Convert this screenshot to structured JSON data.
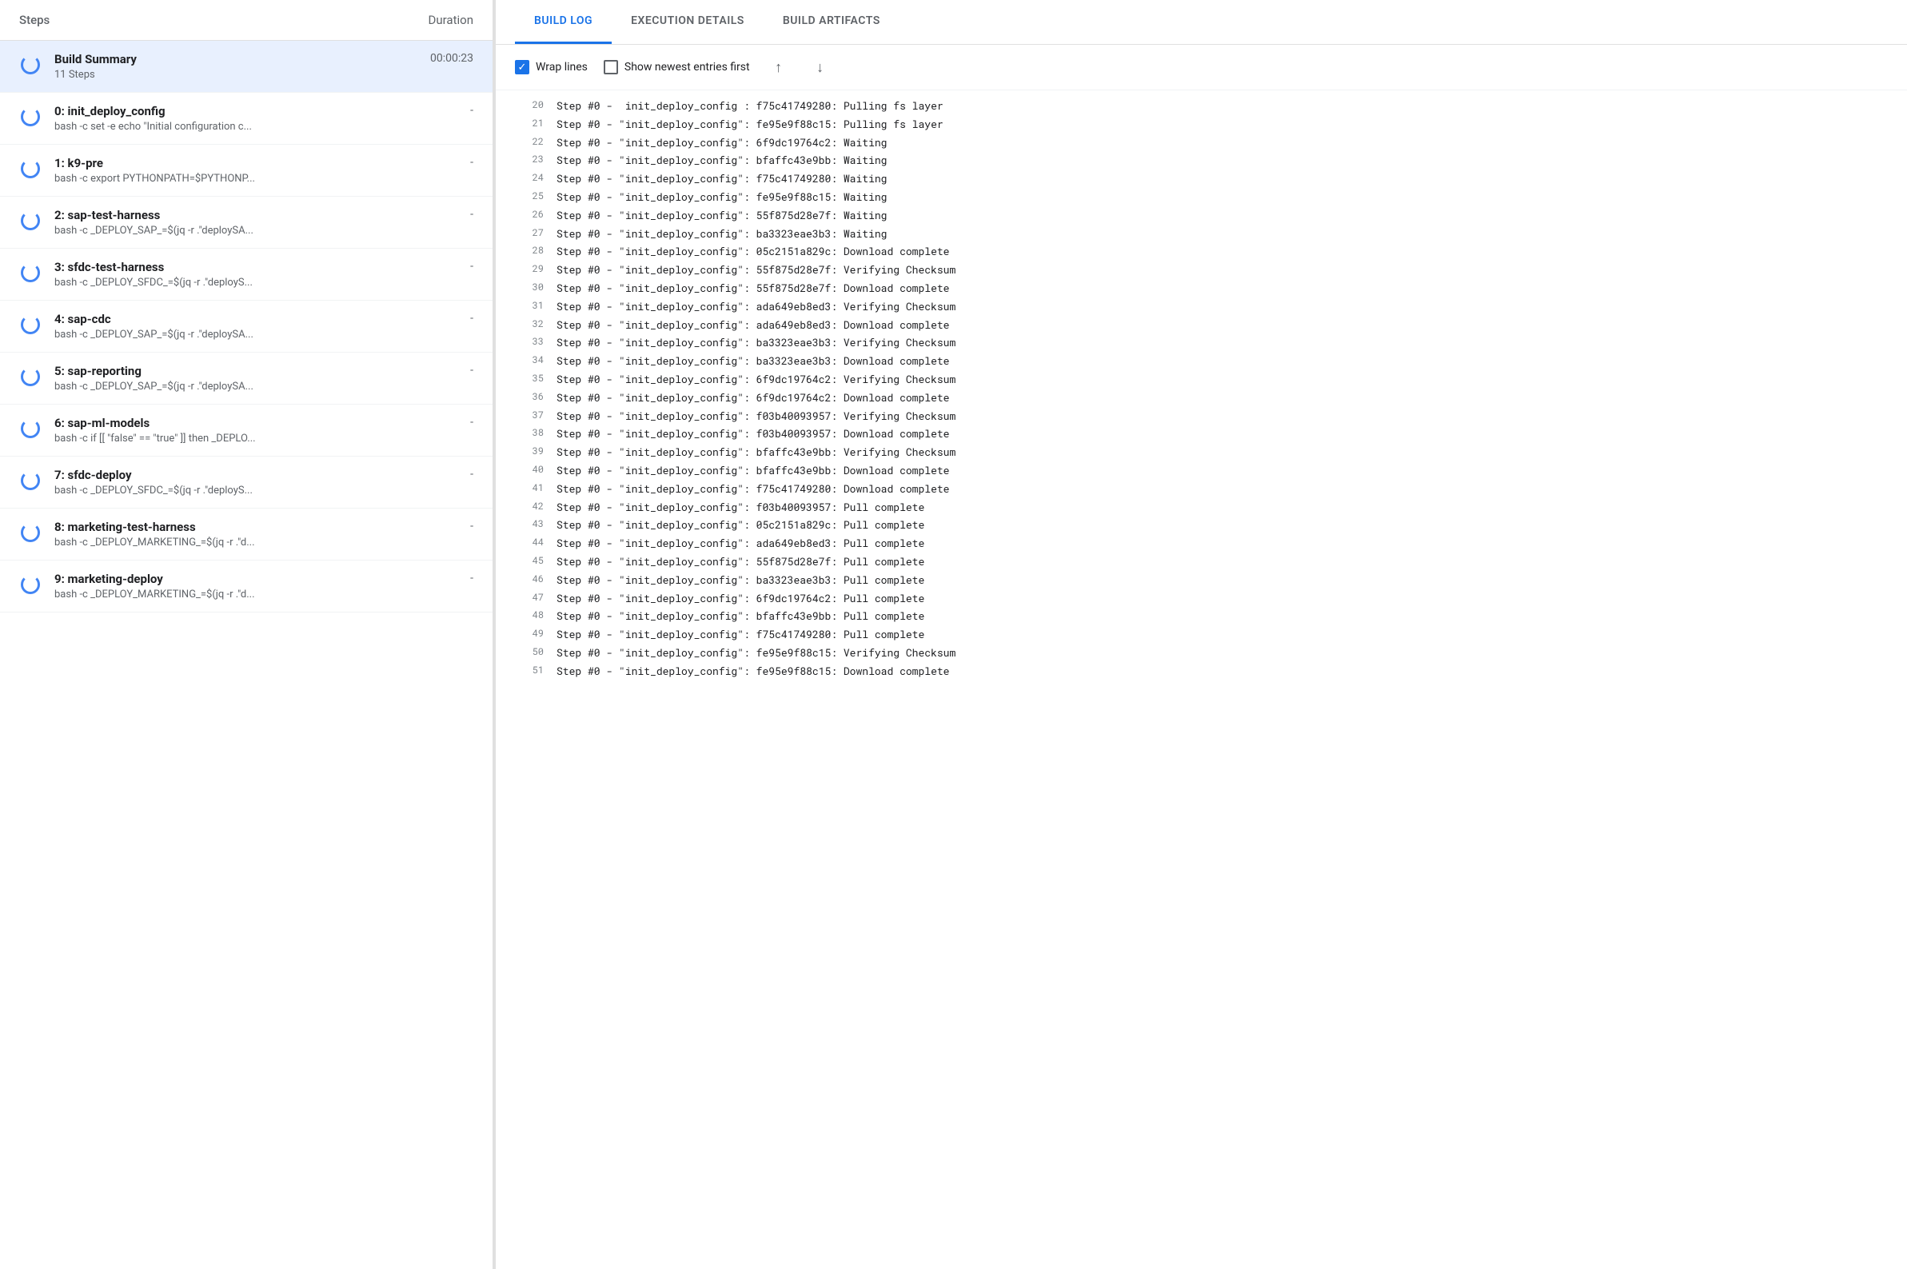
{
  "left": {
    "header": {
      "steps_label": "Steps",
      "duration_label": "Duration"
    },
    "summary": {
      "title": "Build Summary",
      "subtitle": "11 Steps",
      "duration": "00:00:23"
    },
    "steps": [
      {
        "id": 0,
        "name": "0: init_deploy_config",
        "command": "bash -c set -e echo \"Initial configuration c...",
        "duration": "-"
      },
      {
        "id": 1,
        "name": "1: k9-pre",
        "command": "bash -c export PYTHONPATH=$PYTHONP...",
        "duration": "-"
      },
      {
        "id": 2,
        "name": "2: sap-test-harness",
        "command": "bash -c _DEPLOY_SAP_=$(jq -r .\"deploySA...",
        "duration": "-"
      },
      {
        "id": 3,
        "name": "3: sfdc-test-harness",
        "command": "bash -c _DEPLOY_SFDC_=$(jq -r .\"deployS...",
        "duration": "-"
      },
      {
        "id": 4,
        "name": "4: sap-cdc",
        "command": "bash -c _DEPLOY_SAP_=$(jq -r .\"deploySA...",
        "duration": "-"
      },
      {
        "id": 5,
        "name": "5: sap-reporting",
        "command": "bash -c _DEPLOY_SAP_=$(jq -r .\"deploySA...",
        "duration": "-"
      },
      {
        "id": 6,
        "name": "6: sap-ml-models",
        "command": "bash -c if [[ \"false\" == \"true\" ]] then _DEPLO...",
        "duration": "-"
      },
      {
        "id": 7,
        "name": "7: sfdc-deploy",
        "command": "bash -c _DEPLOY_SFDC_=$(jq -r .\"deployS...",
        "duration": "-"
      },
      {
        "id": 8,
        "name": "8: marketing-test-harness",
        "command": "bash -c _DEPLOY_MARKETING_=$(jq -r .\"d...",
        "duration": "-"
      },
      {
        "id": 9,
        "name": "9: marketing-deploy",
        "command": "bash -c _DEPLOY_MARKETING_=$(jq -r .\"d...",
        "duration": "-"
      }
    ]
  },
  "right": {
    "tabs": [
      {
        "label": "BUILD LOG",
        "active": true
      },
      {
        "label": "EXECUTION DETAILS",
        "active": false
      },
      {
        "label": "BUILD ARTIFACTS",
        "active": false
      }
    ],
    "toolbar": {
      "wrap_lines_label": "Wrap lines",
      "wrap_lines_checked": true,
      "show_newest_label": "Show newest entries first",
      "show_newest_checked": false,
      "scroll_top_icon": "↑",
      "scroll_bottom_icon": "↓"
    },
    "log_lines": [
      {
        "num": 20,
        "text": "Step #0 -  init_deploy_config : f75c41749280: Pulling fs layer"
      },
      {
        "num": 21,
        "text": "Step #0 - \"init_deploy_config\": fe95e9f88c15: Pulling fs layer"
      },
      {
        "num": 22,
        "text": "Step #0 - \"init_deploy_config\": 6f9dc19764c2: Waiting"
      },
      {
        "num": 23,
        "text": "Step #0 - \"init_deploy_config\": bfaffc43e9bb: Waiting"
      },
      {
        "num": 24,
        "text": "Step #0 - \"init_deploy_config\": f75c41749280: Waiting"
      },
      {
        "num": 25,
        "text": "Step #0 - \"init_deploy_config\": fe95e9f88c15: Waiting"
      },
      {
        "num": 26,
        "text": "Step #0 - \"init_deploy_config\": 55f875d28e7f: Waiting"
      },
      {
        "num": 27,
        "text": "Step #0 - \"init_deploy_config\": ba3323eae3b3: Waiting"
      },
      {
        "num": 28,
        "text": "Step #0 - \"init_deploy_config\": 05c2151a829c: Download complete"
      },
      {
        "num": 29,
        "text": "Step #0 - \"init_deploy_config\": 55f875d28e7f: Verifying Checksum"
      },
      {
        "num": 30,
        "text": "Step #0 - \"init_deploy_config\": 55f875d28e7f: Download complete"
      },
      {
        "num": 31,
        "text": "Step #0 - \"init_deploy_config\": ada649eb8ed3: Verifying Checksum"
      },
      {
        "num": 32,
        "text": "Step #0 - \"init_deploy_config\": ada649eb8ed3: Download complete"
      },
      {
        "num": 33,
        "text": "Step #0 - \"init_deploy_config\": ba3323eae3b3: Verifying Checksum"
      },
      {
        "num": 34,
        "text": "Step #0 - \"init_deploy_config\": ba3323eae3b3: Download complete"
      },
      {
        "num": 35,
        "text": "Step #0 - \"init_deploy_config\": 6f9dc19764c2: Verifying Checksum"
      },
      {
        "num": 36,
        "text": "Step #0 - \"init_deploy_config\": 6f9dc19764c2: Download complete"
      },
      {
        "num": 37,
        "text": "Step #0 - \"init_deploy_config\": f03b40093957: Verifying Checksum"
      },
      {
        "num": 38,
        "text": "Step #0 - \"init_deploy_config\": f03b40093957: Download complete"
      },
      {
        "num": 39,
        "text": "Step #0 - \"init_deploy_config\": bfaffc43e9bb: Verifying Checksum"
      },
      {
        "num": 40,
        "text": "Step #0 - \"init_deploy_config\": bfaffc43e9bb: Download complete"
      },
      {
        "num": 41,
        "text": "Step #0 - \"init_deploy_config\": f75c41749280: Download complete"
      },
      {
        "num": 42,
        "text": "Step #0 - \"init_deploy_config\": f03b40093957: Pull complete"
      },
      {
        "num": 43,
        "text": "Step #0 - \"init_deploy_config\": 05c2151a829c: Pull complete"
      },
      {
        "num": 44,
        "text": "Step #0 - \"init_deploy_config\": ada649eb8ed3: Pull complete"
      },
      {
        "num": 45,
        "text": "Step #0 - \"init_deploy_config\": 55f875d28e7f: Pull complete"
      },
      {
        "num": 46,
        "text": "Step #0 - \"init_deploy_config\": ba3323eae3b3: Pull complete"
      },
      {
        "num": 47,
        "text": "Step #0 - \"init_deploy_config\": 6f9dc19764c2: Pull complete"
      },
      {
        "num": 48,
        "text": "Step #0 - \"init_deploy_config\": bfaffc43e9bb: Pull complete"
      },
      {
        "num": 49,
        "text": "Step #0 - \"init_deploy_config\": f75c41749280: Pull complete"
      },
      {
        "num": 50,
        "text": "Step #0 - \"init_deploy_config\": fe95e9f88c15: Verifying Checksum"
      },
      {
        "num": 51,
        "text": "Step #0 - \"init_deploy_config\": fe95e9f88c15: Download complete"
      }
    ]
  }
}
